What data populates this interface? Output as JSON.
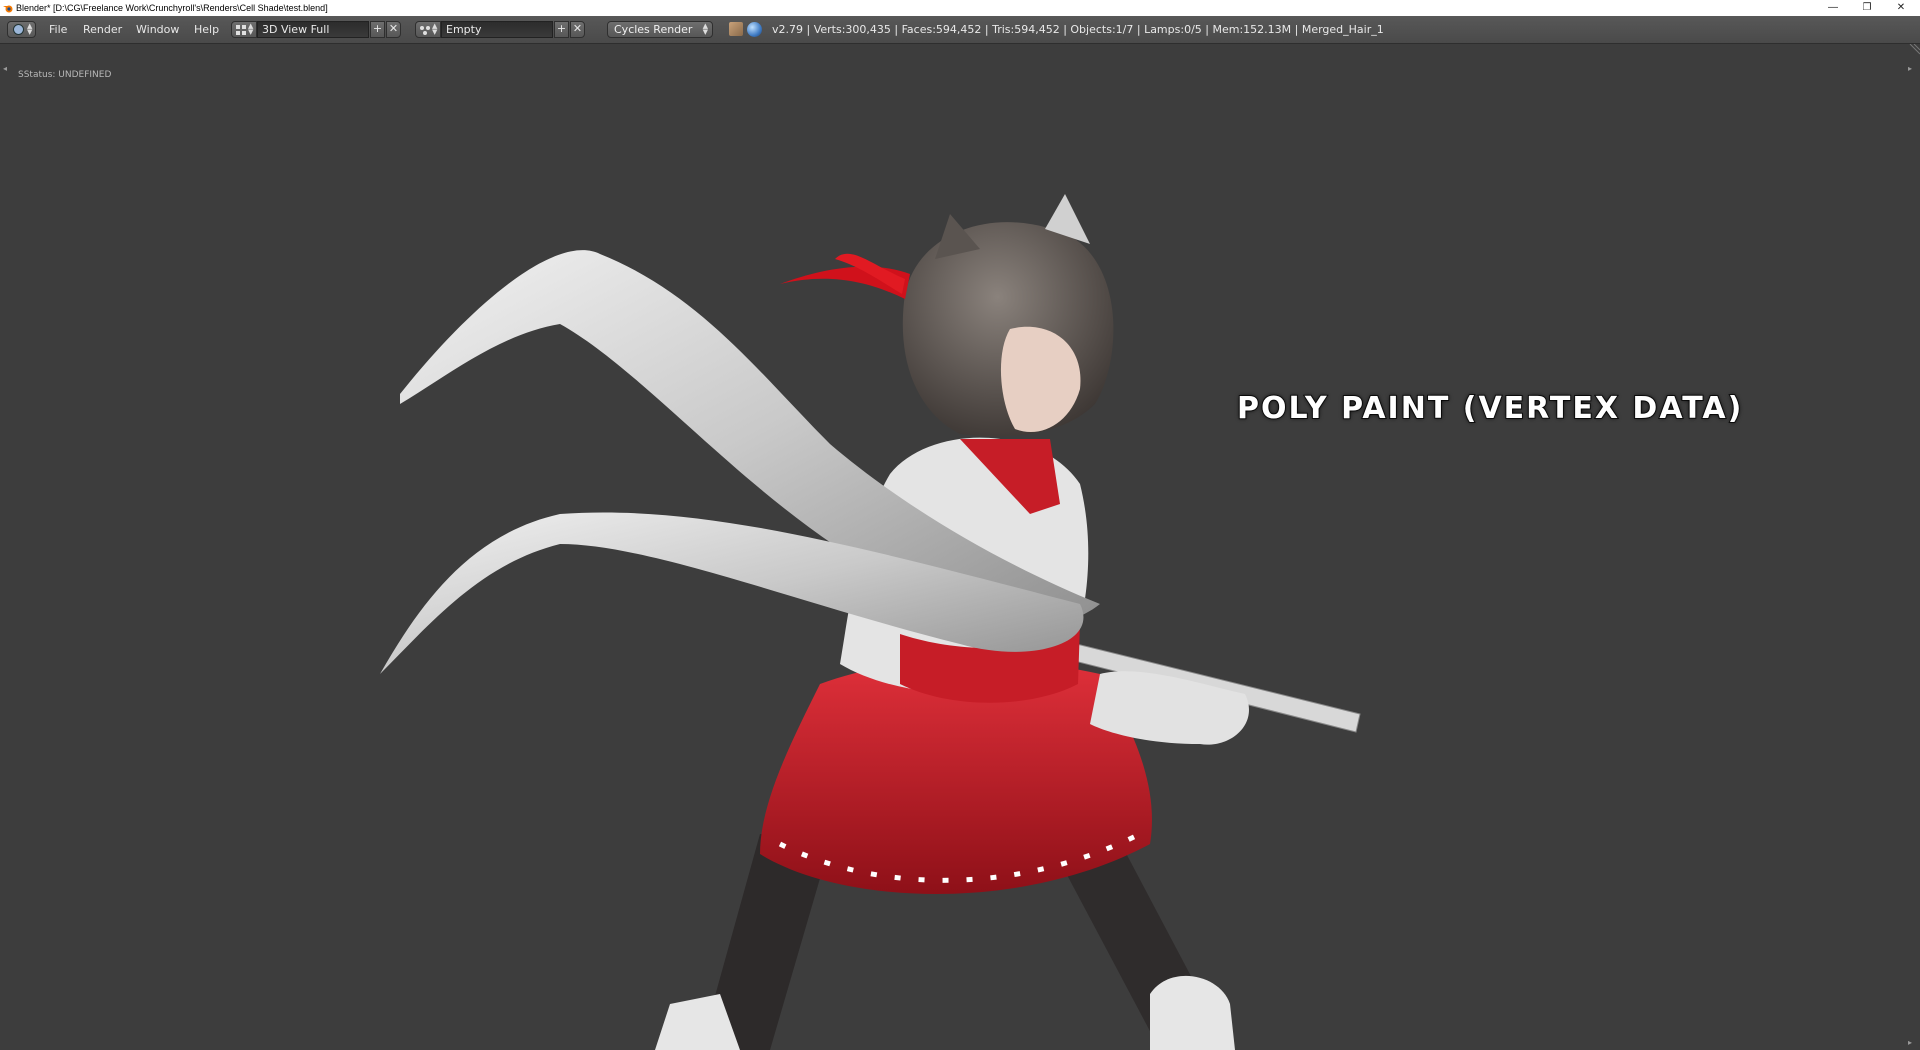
{
  "window": {
    "title": "Blender* [D:\\CG\\Freelance Work\\Crunchyroll's\\Renders\\Cell Shade\\test.blend]",
    "minimize_glyph": "—",
    "maximize_glyph": "❐",
    "close_glyph": "✕"
  },
  "header": {
    "menus": [
      "File",
      "Render",
      "Window",
      "Help"
    ],
    "screen_layout": "3D View Full",
    "scene": "Empty",
    "render_engine": "Cycles Render",
    "add_glyph": "+",
    "remove_glyph": "✕",
    "stats": "v2.79 | Verts:300,435 | Faces:594,452 | Tris:594,452 | Objects:1/7 | Lamps:0/5 | Mem:152.13M | Merged_Hair_1"
  },
  "viewport": {
    "status_text": "SStatus: UNDEFINED",
    "overlay_label": "POLY PAINT (VERTEX DATA)",
    "background_color": "#3d3d3d",
    "scene_description_colors": {
      "cloth_white": "#d9d9d9",
      "skirt_red": "#c0202a",
      "hair_gray": "#5a5450",
      "legs_dark": "#2e2b2b"
    }
  },
  "icons": [
    "blender-logo-icon",
    "info-editor-icon",
    "layout-grid-icon",
    "scene-icon",
    "render-preview-icon",
    "world-globe-icon"
  ]
}
